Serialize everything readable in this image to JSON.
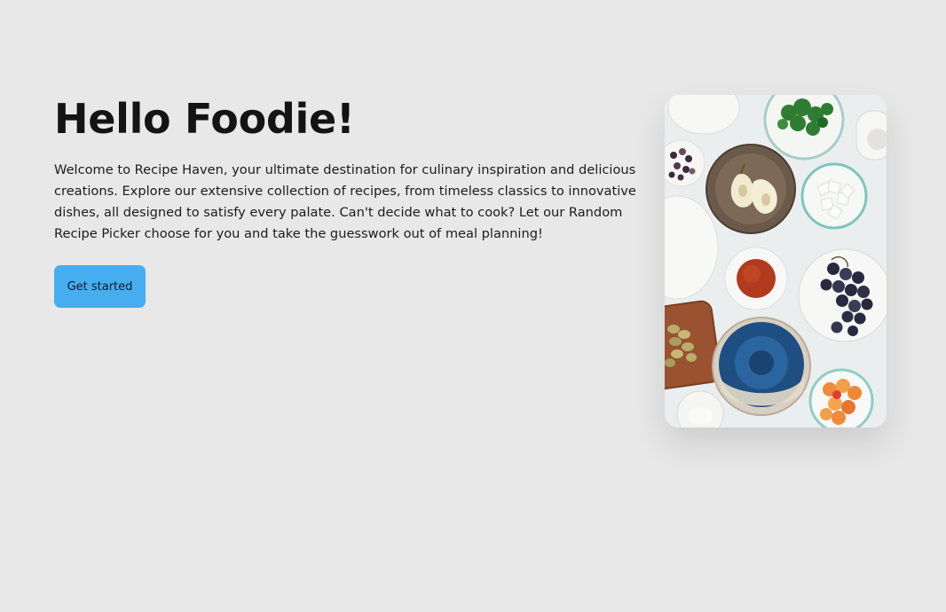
{
  "hero": {
    "title": "Hello Foodie!",
    "description": "Welcome to Recipe Haven, your ultimate destination for culinary inspiration and delicious creations. Explore our extensive collection of recipes, from timeless classics to innovative dishes, all designed to satisfy every palate. Can't decide what to cook? Let our Random Recipe Picker choose for you and take the guesswork out of meal planning!",
    "cta_label": "Get started"
  },
  "colors": {
    "background": "#e8e8e8",
    "button": "#46aef0",
    "title_text": "#141414"
  },
  "image": {
    "subject": "overhead photo of ingredient bowls: pear, herbs, grapes, spice, chickpeas, cherry tomatoes, coconut flakes"
  }
}
